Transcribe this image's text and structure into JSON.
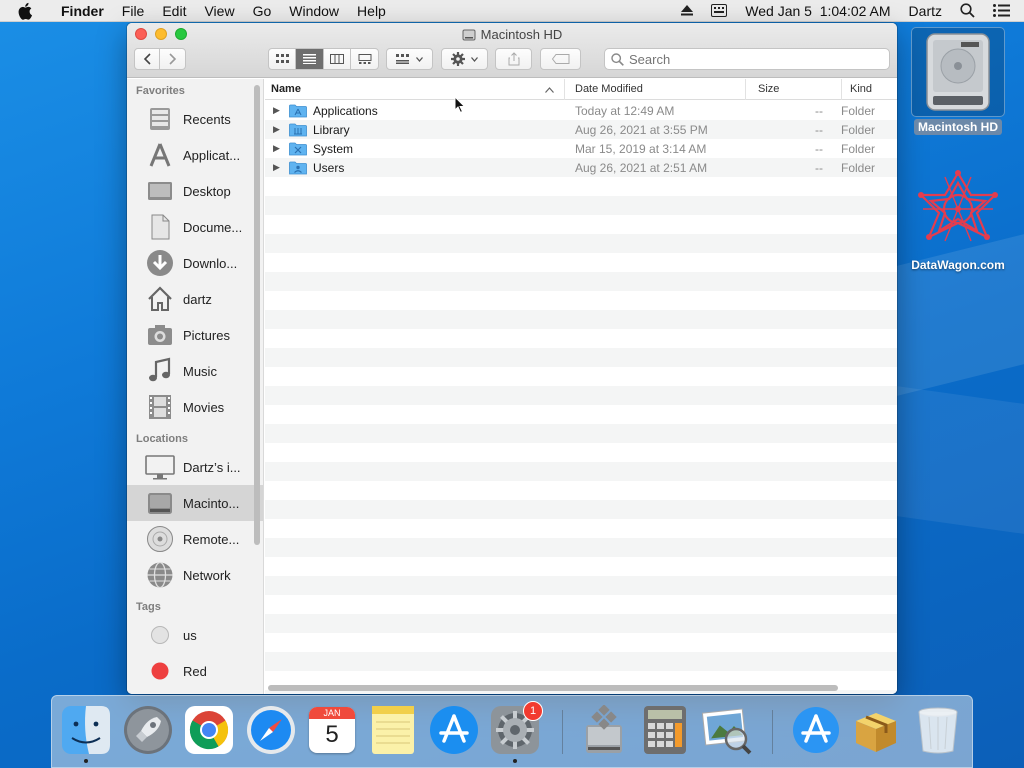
{
  "menubar": {
    "app_name": "Finder",
    "items": [
      "File",
      "Edit",
      "View",
      "Go",
      "Window",
      "Help"
    ],
    "clock": "Wed Jan 5  1:04:02 AM",
    "user": "Dartz"
  },
  "window": {
    "title": "Macintosh HD",
    "search_placeholder": "Search"
  },
  "sidebar": {
    "favorites_label": "Favorites",
    "favorites": [
      "Recents",
      "Applicat...",
      "Desktop",
      "Docume...",
      "Downlo...",
      "dartz",
      "Pictures",
      "Music",
      "Movies"
    ],
    "locations_label": "Locations",
    "locations": [
      "Dartz’s i...",
      "Macinto...",
      "Remote...",
      "Network"
    ],
    "tags_label": "Tags",
    "tags": [
      {
        "label": "us",
        "color": "#e0e0e0"
      },
      {
        "label": "Red",
        "color": "#ee4040"
      }
    ]
  },
  "list": {
    "columns": {
      "name": "Name",
      "date": "Date Modified",
      "size": "Size",
      "kind": "Kind"
    },
    "rows": [
      {
        "name": "Applications",
        "date": "Today at 12:49 AM",
        "size": "--",
        "kind": "Folder"
      },
      {
        "name": "Library",
        "date": "Aug 26, 2021 at 3:55 PM",
        "size": "--",
        "kind": "Folder"
      },
      {
        "name": "System",
        "date": "Mar 15, 2019 at 3:14 AM",
        "size": "--",
        "kind": "Folder"
      },
      {
        "name": "Users",
        "date": "Aug 26, 2021 at 2:51 AM",
        "size": "--",
        "kind": "Folder"
      }
    ]
  },
  "desktop": {
    "hd_label": "Macintosh HD",
    "datawagon_label": "DataWagon.com"
  },
  "dock": {
    "calendar_month": "JAN",
    "calendar_day": "5",
    "sysprefs_badge": "1"
  },
  "colors": {
    "accent": "#1a8cf0",
    "folder": "#5fb3f0",
    "desktop": "#0f7ad8"
  }
}
